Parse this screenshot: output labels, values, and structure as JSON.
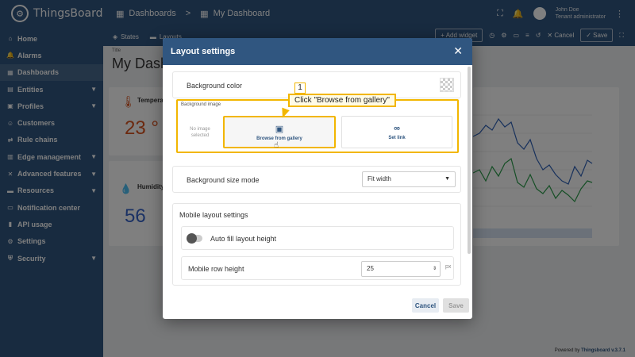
{
  "app": {
    "brand": "ThingsBoard"
  },
  "sidebar": {
    "items": [
      {
        "label": "Home",
        "icon": "home-icon",
        "glyph": "⌂"
      },
      {
        "label": "Alarms",
        "icon": "bell-icon",
        "glyph": "🔔"
      },
      {
        "label": "Dashboards",
        "icon": "grid-icon",
        "glyph": "▦"
      },
      {
        "label": "Entities",
        "icon": "entities-icon",
        "glyph": "▤"
      },
      {
        "label": "Profiles",
        "icon": "profiles-icon",
        "glyph": "▣"
      },
      {
        "label": "Customers",
        "icon": "people-icon",
        "glyph": "☺"
      },
      {
        "label": "Rule chains",
        "icon": "chain-icon",
        "glyph": "⇄"
      },
      {
        "label": "Edge management",
        "icon": "edge-icon",
        "glyph": "▥"
      },
      {
        "label": "Advanced features",
        "icon": "tools-icon",
        "glyph": "✕"
      },
      {
        "label": "Resources",
        "icon": "folder-icon",
        "glyph": "▬"
      },
      {
        "label": "Notification center",
        "icon": "inbox-icon",
        "glyph": "▭"
      },
      {
        "label": "API usage",
        "icon": "chart-icon",
        "glyph": "▮"
      },
      {
        "label": "Settings",
        "icon": "gear-icon",
        "glyph": "⚙"
      },
      {
        "label": "Security",
        "icon": "shield-icon",
        "glyph": "⛨"
      }
    ]
  },
  "topbar": {
    "crumb1": "Dashboards",
    "crumb_sep": ">",
    "crumb2": "My Dashboard",
    "user_name": "John Doe",
    "user_role": "Tenant administrator"
  },
  "toolbar": {
    "states": "States",
    "layouts": "Layouts",
    "add_widget": "+ Add widget",
    "cancel": "✕ Cancel",
    "save": "✓ Save"
  },
  "dashboard": {
    "title_small": "Title",
    "title": "My Dash",
    "card1_label": "Tempera",
    "card1_value": "23 °",
    "card2_label": "Humidity",
    "card2_value": "56 ",
    "footer_prefix": "Powered by ",
    "footer_brand": "Thingsboard v.3.7.1"
  },
  "dialog": {
    "title": "Layout settings",
    "bg_color_label": "Background color",
    "bg_image_label": "Background image",
    "no_image": "No image selected",
    "browse": "Browse from gallery",
    "set_link": "Set link",
    "size_mode_label": "Background size mode",
    "size_mode_value": "Fit width",
    "mobile_title": "Mobile layout settings",
    "auto_fill": "Auto fill layout height",
    "row_height_label": "Mobile row height",
    "row_height_value": "25",
    "row_height_unit": "px",
    "cancel": "Cancel",
    "save": "Save"
  },
  "callout": {
    "step": "1",
    "text": "Click \"Browse from gallery\""
  },
  "colors": {
    "brand": "#305680",
    "highlight": "#f2b600"
  }
}
